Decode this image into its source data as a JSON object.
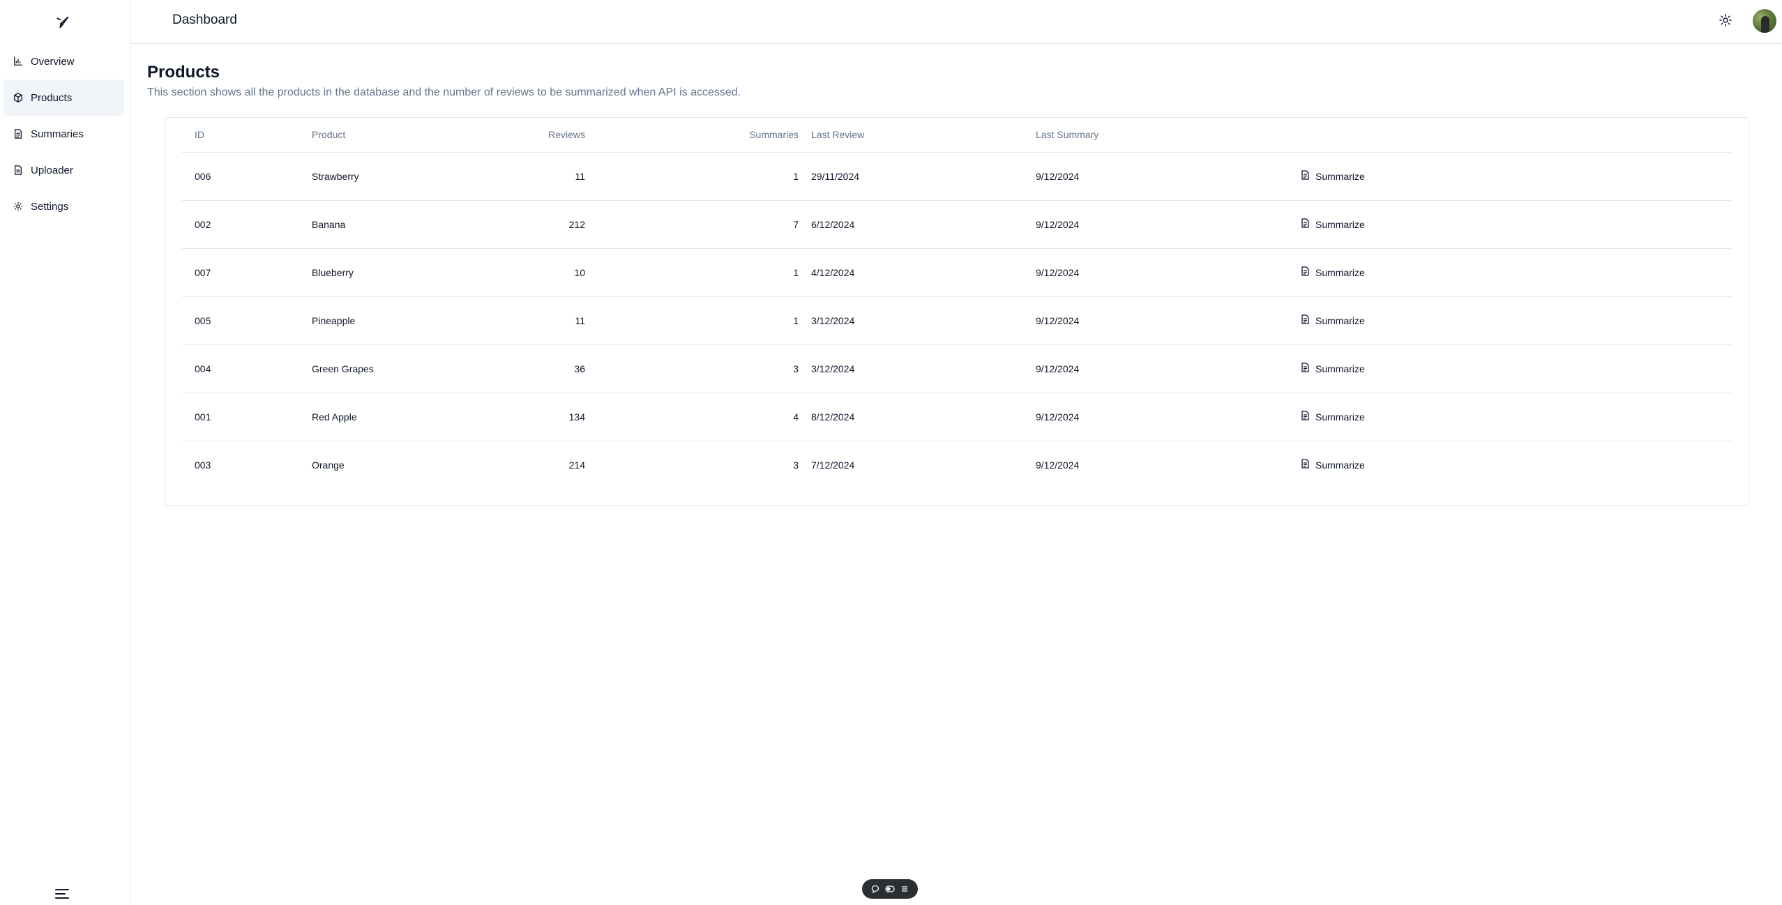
{
  "header": {
    "title": "Dashboard"
  },
  "sidebar": {
    "items": [
      {
        "label": "Overview",
        "icon": "chart-icon"
      },
      {
        "label": "Products",
        "icon": "box-icon",
        "active": true
      },
      {
        "label": "Summaries",
        "icon": "document-icon"
      },
      {
        "label": "Uploader",
        "icon": "file-icon"
      },
      {
        "label": "Settings",
        "icon": "gear-icon"
      }
    ]
  },
  "page": {
    "title": "Products",
    "description": "This section shows all the products in the database and the number of reviews to be summarized when API is accessed."
  },
  "table": {
    "columns": [
      "ID",
      "Product",
      "Reviews",
      "Summaries",
      "Last Review",
      "Last Summary"
    ],
    "action_label": "Summarize",
    "rows": [
      {
        "id": "006",
        "product": "Strawberry",
        "reviews": "11",
        "summaries": "1",
        "last_review": "29/11/2024",
        "last_summary": "9/12/2024"
      },
      {
        "id": "002",
        "product": "Banana",
        "reviews": "212",
        "summaries": "7",
        "last_review": "6/12/2024",
        "last_summary": "9/12/2024"
      },
      {
        "id": "007",
        "product": "Blueberry",
        "reviews": "10",
        "summaries": "1",
        "last_review": "4/12/2024",
        "last_summary": "9/12/2024"
      },
      {
        "id": "005",
        "product": "Pineapple",
        "reviews": "11",
        "summaries": "1",
        "last_review": "3/12/2024",
        "last_summary": "9/12/2024"
      },
      {
        "id": "004",
        "product": "Green Grapes",
        "reviews": "36",
        "summaries": "3",
        "last_review": "3/12/2024",
        "last_summary": "9/12/2024"
      },
      {
        "id": "001",
        "product": "Red Apple",
        "reviews": "134",
        "summaries": "4",
        "last_review": "8/12/2024",
        "last_summary": "9/12/2024"
      },
      {
        "id": "003",
        "product": "Orange",
        "reviews": "214",
        "summaries": "3",
        "last_review": "7/12/2024",
        "last_summary": "9/12/2024"
      }
    ]
  },
  "colors": {
    "muted": "#64748b",
    "active_bg": "#f1f5f9",
    "border": "#e5e7eb",
    "toolbar": "#2b2f33"
  }
}
